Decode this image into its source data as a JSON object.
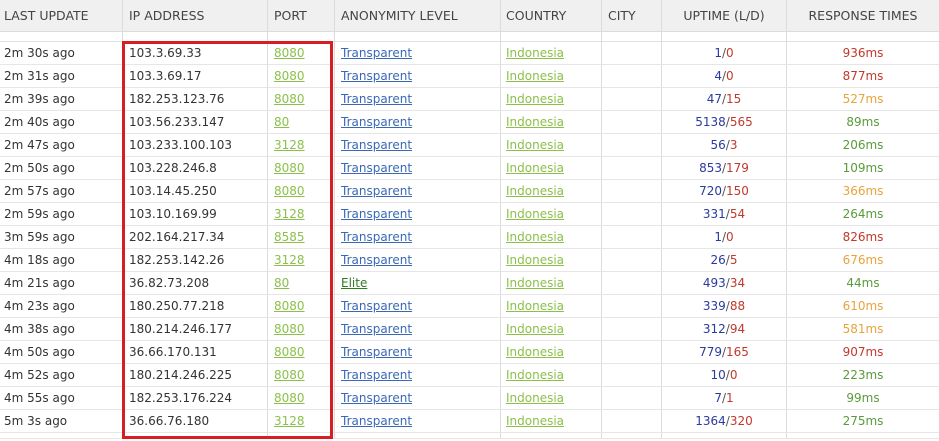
{
  "columns": {
    "last_update": "LAST UPDATE",
    "ip_address": "IP ADDRESS",
    "port": "PORT",
    "anonymity": "ANONYMITY LEVEL",
    "country": "COUNTRY",
    "city": "CITY",
    "uptime": "UPTIME (L/D)",
    "response": "RESPONSE TIMES"
  },
  "colors": {
    "port": "#8cc04b",
    "country": "#8cc04b",
    "transparent": "#3a68b5",
    "elite": "#2f7d1f",
    "uptime_l": "#2b3a9e",
    "uptime_d": "#c0392b",
    "response_fast": "#5b9a3c",
    "response_medium": "#e8a33d",
    "response_slow": "#c0392b",
    "highlight_box": "#d81e25"
  },
  "rows": [
    {
      "updated": "2m 30s ago",
      "ip": "103.3.69.33",
      "port": "8080",
      "anonymity": "Transparent",
      "country": "Indonesia",
      "city": "",
      "up": "1",
      "down": "0",
      "response": "936ms",
      "speed": "slow"
    },
    {
      "updated": "2m 31s ago",
      "ip": "103.3.69.17",
      "port": "8080",
      "anonymity": "Transparent",
      "country": "Indonesia",
      "city": "",
      "up": "4",
      "down": "0",
      "response": "877ms",
      "speed": "slow"
    },
    {
      "updated": "2m 39s ago",
      "ip": "182.253.123.76",
      "port": "8080",
      "anonymity": "Transparent",
      "country": "Indonesia",
      "city": "",
      "up": "47",
      "down": "15",
      "response": "527ms",
      "speed": "medium"
    },
    {
      "updated": "2m 40s ago",
      "ip": "103.56.233.147",
      "port": "80",
      "anonymity": "Transparent",
      "country": "Indonesia",
      "city": "",
      "up": "5138",
      "down": "565",
      "response": "89ms",
      "speed": "fast"
    },
    {
      "updated": "2m 47s ago",
      "ip": "103.233.100.103",
      "port": "3128",
      "anonymity": "Transparent",
      "country": "Indonesia",
      "city": "",
      "up": "56",
      "down": "3",
      "response": "206ms",
      "speed": "fast"
    },
    {
      "updated": "2m 50s ago",
      "ip": "103.228.246.8",
      "port": "8080",
      "anonymity": "Transparent",
      "country": "Indonesia",
      "city": "",
      "up": "853",
      "down": "179",
      "response": "109ms",
      "speed": "fast"
    },
    {
      "updated": "2m 57s ago",
      "ip": "103.14.45.250",
      "port": "8080",
      "anonymity": "Transparent",
      "country": "Indonesia",
      "city": "",
      "up": "720",
      "down": "150",
      "response": "366ms",
      "speed": "medium"
    },
    {
      "updated": "2m 59s ago",
      "ip": "103.10.169.99",
      "port": "3128",
      "anonymity": "Transparent",
      "country": "Indonesia",
      "city": "",
      "up": "331",
      "down": "54",
      "response": "264ms",
      "speed": "fast"
    },
    {
      "updated": "3m 59s ago",
      "ip": "202.164.217.34",
      "port": "8585",
      "anonymity": "Transparent",
      "country": "Indonesia",
      "city": "",
      "up": "1",
      "down": "0",
      "response": "826ms",
      "speed": "slow"
    },
    {
      "updated": "4m 18s ago",
      "ip": "182.253.142.26",
      "port": "3128",
      "anonymity": "Transparent",
      "country": "Indonesia",
      "city": "",
      "up": "26",
      "down": "5",
      "response": "676ms",
      "speed": "medium"
    },
    {
      "updated": "4m 21s ago",
      "ip": "36.82.73.208",
      "port": "80",
      "anonymity": "Elite",
      "country": "Indonesia",
      "city": "",
      "up": "493",
      "down": "34",
      "response": "44ms",
      "speed": "fast"
    },
    {
      "updated": "4m 23s ago",
      "ip": "180.250.77.218",
      "port": "8080",
      "anonymity": "Transparent",
      "country": "Indonesia",
      "city": "",
      "up": "339",
      "down": "88",
      "response": "610ms",
      "speed": "medium"
    },
    {
      "updated": "4m 38s ago",
      "ip": "180.214.246.177",
      "port": "8080",
      "anonymity": "Transparent",
      "country": "Indonesia",
      "city": "",
      "up": "312",
      "down": "94",
      "response": "581ms",
      "speed": "medium"
    },
    {
      "updated": "4m 50s ago",
      "ip": "36.66.170.131",
      "port": "8080",
      "anonymity": "Transparent",
      "country": "Indonesia",
      "city": "",
      "up": "779",
      "down": "165",
      "response": "907ms",
      "speed": "slow"
    },
    {
      "updated": "4m 52s ago",
      "ip": "180.214.246.225",
      "port": "8080",
      "anonymity": "Transparent",
      "country": "Indonesia",
      "city": "",
      "up": "10",
      "down": "0",
      "response": "223ms",
      "speed": "fast"
    },
    {
      "updated": "4m 55s ago",
      "ip": "182.253.176.224",
      "port": "8080",
      "anonymity": "Transparent",
      "country": "Indonesia",
      "city": "",
      "up": "7",
      "down": "1",
      "response": "99ms",
      "speed": "fast"
    },
    {
      "updated": "5m 3s ago",
      "ip": "36.66.76.180",
      "port": "3128",
      "anonymity": "Transparent",
      "country": "Indonesia",
      "city": "",
      "up": "1364",
      "down": "320",
      "response": "275ms",
      "speed": "fast"
    }
  ]
}
